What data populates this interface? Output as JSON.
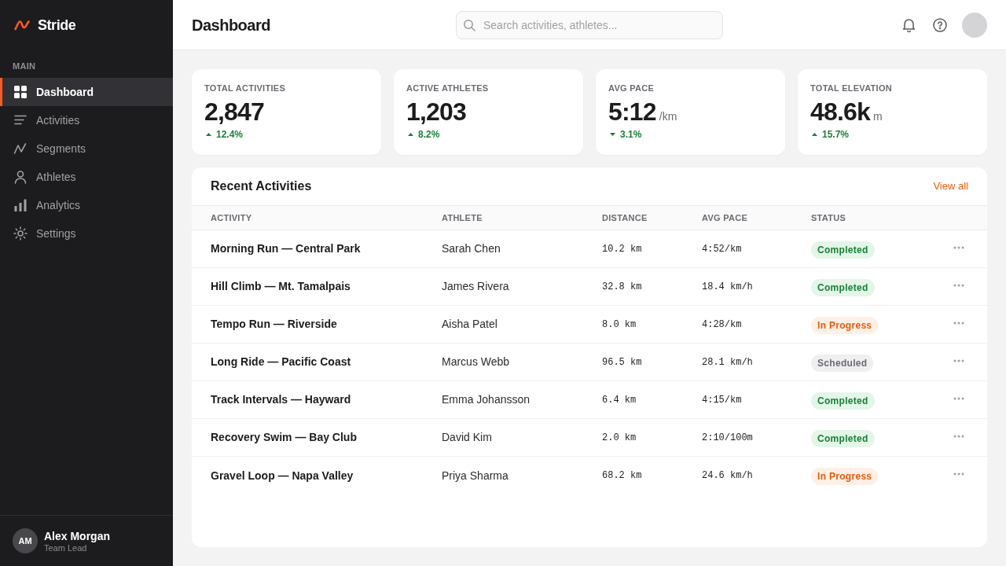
{
  "sidebar": {
    "brand": "Stride",
    "section_label": "MAIN",
    "items": [
      {
        "label": "Dashboard",
        "selected": true
      },
      {
        "label": "Activities",
        "selected": false
      },
      {
        "label": "Segments",
        "selected": false
      },
      {
        "label": "Athletes",
        "selected": false
      },
      {
        "label": "Analytics",
        "selected": false
      },
      {
        "label": "Settings",
        "selected": false
      }
    ],
    "user": {
      "initials": "AM",
      "name": "Alex Morgan",
      "role": "Team Lead"
    }
  },
  "header": {
    "title": "Dashboard",
    "search": {
      "placeholder": "Search activities, athletes..."
    }
  },
  "stats": [
    {
      "label": "TOTAL ACTIVITIES",
      "value": "2,847",
      "change": "12.4%",
      "kind": "up"
    },
    {
      "label": "ACTIVE ATHLETES",
      "value": "1,203",
      "change": "8.2%",
      "kind": "up"
    },
    {
      "label": "AVG PACE",
      "value": "5:12",
      "unit": "/km",
      "change": "3.1%",
      "kind": "down"
    },
    {
      "label": "TOTAL ELEVATION",
      "value": "48.6k",
      "unit": "m",
      "change": "15.7%",
      "kind": "up"
    }
  ],
  "recent_activities": {
    "title": "Recent Activities",
    "link": "View all",
    "columns": [
      "ACTIVITY",
      "ATHLETE",
      "DISTANCE",
      "AVG PACE",
      "STATUS"
    ],
    "rows": [
      {
        "activity": "Morning Run — Central Park",
        "athlete": "Sarah Chen",
        "distance": "10.2 km",
        "pace": "4:52/km",
        "status": {
          "label": "Completed",
          "kind": "completed"
        }
      },
      {
        "activity": "Hill Climb — Mt. Tamalpais",
        "athlete": "James Rivera",
        "distance": "32.8 km",
        "pace": "18.4 km/h",
        "status": {
          "label": "Completed",
          "kind": "completed"
        }
      },
      {
        "activity": "Tempo Run — Riverside",
        "athlete": "Aisha Patel",
        "distance": "8.0 km",
        "pace": "4:28/km",
        "status": {
          "label": "In Progress",
          "kind": "in_progress"
        }
      },
      {
        "activity": "Long Ride — Pacific Coast",
        "athlete": "Marcus Webb",
        "distance": "96.5 km",
        "pace": "28.1 km/h",
        "status": {
          "label": "Scheduled",
          "kind": "scheduled"
        }
      },
      {
        "activity": "Track Intervals — Hayward",
        "athlete": "Emma Johansson",
        "distance": "6.4 km",
        "pace": "4:15/km",
        "status": {
          "label": "Completed",
          "kind": "completed"
        }
      },
      {
        "activity": "Recovery Swim — Bay Club",
        "athlete": "David Kim",
        "distance": "2.0 km",
        "pace": "2:10/100m",
        "status": {
          "label": "Completed",
          "kind": "completed"
        }
      },
      {
        "activity": "Gravel Loop — Napa Valley",
        "athlete": "Priya Sharma",
        "distance": "68.2 km",
        "pace": "24.6 km/h",
        "status": {
          "label": "In Progress",
          "kind": "in_progress"
        }
      }
    ]
  }
}
